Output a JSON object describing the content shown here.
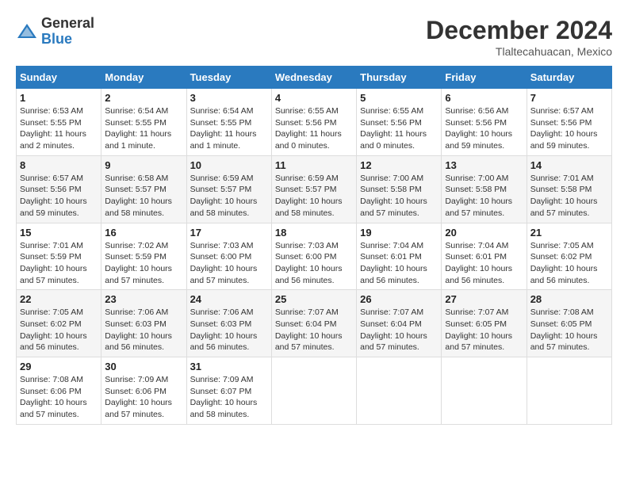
{
  "header": {
    "logo_general": "General",
    "logo_blue": "Blue",
    "title": "December 2024",
    "location": "Tlaltecahuacan, Mexico"
  },
  "columns": [
    "Sunday",
    "Monday",
    "Tuesday",
    "Wednesday",
    "Thursday",
    "Friday",
    "Saturday"
  ],
  "weeks": [
    [
      {
        "day": "1",
        "sunrise": "6:53 AM",
        "sunset": "5:55 PM",
        "daylight": "11 hours and 2 minutes."
      },
      {
        "day": "2",
        "sunrise": "6:54 AM",
        "sunset": "5:55 PM",
        "daylight": "11 hours and 1 minute."
      },
      {
        "day": "3",
        "sunrise": "6:54 AM",
        "sunset": "5:55 PM",
        "daylight": "11 hours and 1 minute."
      },
      {
        "day": "4",
        "sunrise": "6:55 AM",
        "sunset": "5:56 PM",
        "daylight": "11 hours and 0 minutes."
      },
      {
        "day": "5",
        "sunrise": "6:55 AM",
        "sunset": "5:56 PM",
        "daylight": "11 hours and 0 minutes."
      },
      {
        "day": "6",
        "sunrise": "6:56 AM",
        "sunset": "5:56 PM",
        "daylight": "10 hours and 59 minutes."
      },
      {
        "day": "7",
        "sunrise": "6:57 AM",
        "sunset": "5:56 PM",
        "daylight": "10 hours and 59 minutes."
      }
    ],
    [
      {
        "day": "8",
        "sunrise": "6:57 AM",
        "sunset": "5:56 PM",
        "daylight": "10 hours and 59 minutes."
      },
      {
        "day": "9",
        "sunrise": "6:58 AM",
        "sunset": "5:57 PM",
        "daylight": "10 hours and 58 minutes."
      },
      {
        "day": "10",
        "sunrise": "6:59 AM",
        "sunset": "5:57 PM",
        "daylight": "10 hours and 58 minutes."
      },
      {
        "day": "11",
        "sunrise": "6:59 AM",
        "sunset": "5:57 PM",
        "daylight": "10 hours and 58 minutes."
      },
      {
        "day": "12",
        "sunrise": "7:00 AM",
        "sunset": "5:58 PM",
        "daylight": "10 hours and 57 minutes."
      },
      {
        "day": "13",
        "sunrise": "7:00 AM",
        "sunset": "5:58 PM",
        "daylight": "10 hours and 57 minutes."
      },
      {
        "day": "14",
        "sunrise": "7:01 AM",
        "sunset": "5:58 PM",
        "daylight": "10 hours and 57 minutes."
      }
    ],
    [
      {
        "day": "15",
        "sunrise": "7:01 AM",
        "sunset": "5:59 PM",
        "daylight": "10 hours and 57 minutes."
      },
      {
        "day": "16",
        "sunrise": "7:02 AM",
        "sunset": "5:59 PM",
        "daylight": "10 hours and 57 minutes."
      },
      {
        "day": "17",
        "sunrise": "7:03 AM",
        "sunset": "6:00 PM",
        "daylight": "10 hours and 57 minutes."
      },
      {
        "day": "18",
        "sunrise": "7:03 AM",
        "sunset": "6:00 PM",
        "daylight": "10 hours and 56 minutes."
      },
      {
        "day": "19",
        "sunrise": "7:04 AM",
        "sunset": "6:01 PM",
        "daylight": "10 hours and 56 minutes."
      },
      {
        "day": "20",
        "sunrise": "7:04 AM",
        "sunset": "6:01 PM",
        "daylight": "10 hours and 56 minutes."
      },
      {
        "day": "21",
        "sunrise": "7:05 AM",
        "sunset": "6:02 PM",
        "daylight": "10 hours and 56 minutes."
      }
    ],
    [
      {
        "day": "22",
        "sunrise": "7:05 AM",
        "sunset": "6:02 PM",
        "daylight": "10 hours and 56 minutes."
      },
      {
        "day": "23",
        "sunrise": "7:06 AM",
        "sunset": "6:03 PM",
        "daylight": "10 hours and 56 minutes."
      },
      {
        "day": "24",
        "sunrise": "7:06 AM",
        "sunset": "6:03 PM",
        "daylight": "10 hours and 56 minutes."
      },
      {
        "day": "25",
        "sunrise": "7:07 AM",
        "sunset": "6:04 PM",
        "daylight": "10 hours and 57 minutes."
      },
      {
        "day": "26",
        "sunrise": "7:07 AM",
        "sunset": "6:04 PM",
        "daylight": "10 hours and 57 minutes."
      },
      {
        "day": "27",
        "sunrise": "7:07 AM",
        "sunset": "6:05 PM",
        "daylight": "10 hours and 57 minutes."
      },
      {
        "day": "28",
        "sunrise": "7:08 AM",
        "sunset": "6:05 PM",
        "daylight": "10 hours and 57 minutes."
      }
    ],
    [
      {
        "day": "29",
        "sunrise": "7:08 AM",
        "sunset": "6:06 PM",
        "daylight": "10 hours and 57 minutes."
      },
      {
        "day": "30",
        "sunrise": "7:09 AM",
        "sunset": "6:06 PM",
        "daylight": "10 hours and 57 minutes."
      },
      {
        "day": "31",
        "sunrise": "7:09 AM",
        "sunset": "6:07 PM",
        "daylight": "10 hours and 58 minutes."
      },
      null,
      null,
      null,
      null
    ]
  ]
}
